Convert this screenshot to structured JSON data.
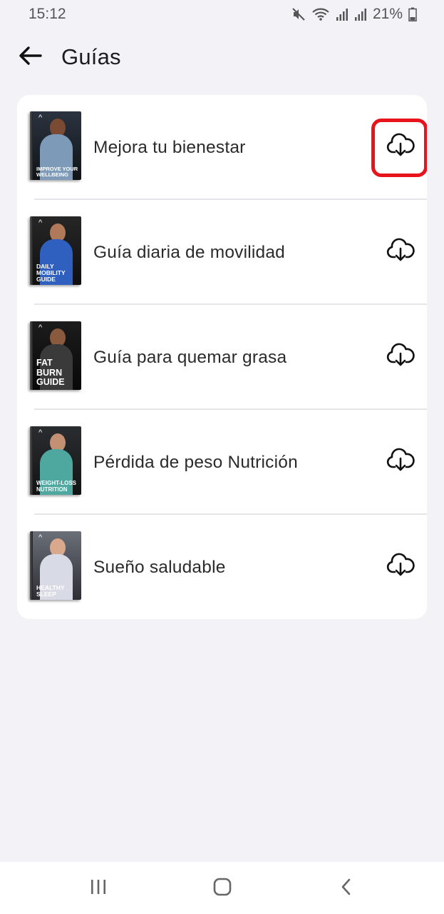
{
  "status_bar": {
    "time": "15:12",
    "battery": "21%",
    "icons": [
      "mute-icon",
      "wifi-icon",
      "signal-icon",
      "signal-icon",
      "battery-icon"
    ]
  },
  "header": {
    "title": "Guías",
    "back_icon": "arrow-left-icon"
  },
  "guides": [
    {
      "label": "Mejora tu bienestar",
      "cover_text": "IMPROVE YOUR WELLBEING",
      "action_icon": "cloud-download-icon",
      "highlighted": true
    },
    {
      "label": "Guía diaria de movilidad",
      "cover_text": "DAILY MOBILITY GUIDE",
      "action_icon": "cloud-download-icon",
      "highlighted": false
    },
    {
      "label": "Guía para quemar grasa",
      "cover_text": "FAT BURN GUIDE",
      "action_icon": "cloud-download-icon",
      "highlighted": false
    },
    {
      "label": "Pérdida de peso Nutrición",
      "cover_text": "WEIGHT-LOSS NUTRITION",
      "action_icon": "cloud-download-icon",
      "highlighted": false
    },
    {
      "label": "Sueño saludable",
      "cover_text": "HEALTHY SLEEP",
      "action_icon": "cloud-download-icon",
      "highlighted": false
    }
  ],
  "nav_bar": {
    "icons": [
      "recent-apps-icon",
      "home-icon",
      "back-icon"
    ]
  },
  "colors": {
    "background": "#f2f2f7",
    "card": "#ffffff",
    "highlight": "#e8141c",
    "text": "#2b2b2b"
  }
}
